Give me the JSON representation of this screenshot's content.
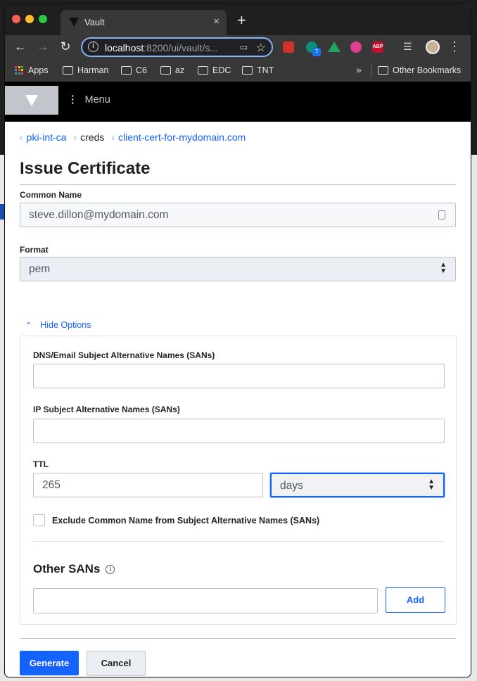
{
  "browser": {
    "tab_title": "Vault",
    "tab_close": "×",
    "new_tab": "+",
    "url_host": "localhost",
    "url_rest": ":8200/ui/vault/s...",
    "bookmarks": [
      {
        "label": "Apps"
      },
      {
        "label": "Harman"
      },
      {
        "label": "C6"
      },
      {
        "label": "az"
      },
      {
        "label": "EDC"
      },
      {
        "label": "TNT"
      }
    ],
    "bookmarks_overflow": "»",
    "other_bookmarks": "Other Bookmarks",
    "extension_badge": "7",
    "abp_label": "ABP"
  },
  "vault": {
    "menu_label": "Menu"
  },
  "breadcrumb": [
    {
      "label": "pki-int-ca"
    },
    {
      "label": "creds"
    },
    {
      "label": "client-cert-for-mydomain.com"
    }
  ],
  "page_title": "Issue Certificate",
  "form": {
    "common_name": {
      "label": "Common Name",
      "value": "steve.dillon@mydomain.com"
    },
    "format": {
      "label": "Format",
      "value": "pem"
    },
    "hide_options": "Hide Options",
    "dns_sans": {
      "label": "DNS/Email Subject Alternative Names (SANs)",
      "value": ""
    },
    "ip_sans": {
      "label": "IP Subject Alternative Names (SANs)",
      "value": ""
    },
    "ttl": {
      "label": "TTL",
      "value": "265",
      "unit": "days"
    },
    "exclude_cn": {
      "label": "Exclude Common Name from Subject Alternative Names (SANs)",
      "checked": false
    },
    "other_sans": {
      "heading": "Other SANs",
      "value": "",
      "add_label": "Add"
    },
    "generate_label": "Generate",
    "cancel_label": "Cancel"
  },
  "colors": {
    "accent": "#1563ff",
    "header_bg": "#000000",
    "logo_bg": "#c2c5cb"
  }
}
